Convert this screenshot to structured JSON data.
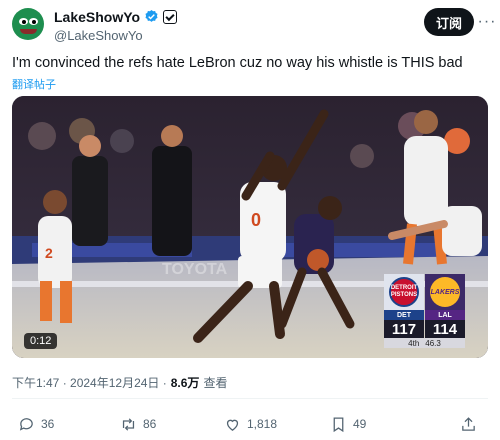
{
  "author": {
    "display_name": "LakeShowYo",
    "handle": "@LakeShowYo",
    "verified_color": "#1d9bf0"
  },
  "header": {
    "follow_label": "订阅",
    "more_label": "···"
  },
  "tweet": {
    "text": "I'm convinced the refs hate LeBron cuz no way his whistle is THIS bad",
    "translate_label": "翻译帖子"
  },
  "video": {
    "duration": "0:12",
    "scoreboard": {
      "home_logo_text": "DETROIT PISTONS",
      "away_logo_text": "LAKERS",
      "home_abbr": "DET",
      "away_abbr": "LAL",
      "home_score": "117",
      "away_score": "114",
      "period": "4th",
      "clock": "46.3"
    }
  },
  "meta": {
    "time": "下午1:47 · 2024年12月24日 ·",
    "views_count": "8.6万",
    "views_label": "查看"
  },
  "actions": {
    "replies": "36",
    "reposts": "86",
    "likes": "1,818",
    "bookmarks": "49"
  },
  "colors": {
    "follow_bg": "#0f1419",
    "link": "#1d9bf0",
    "muted": "#536471"
  }
}
